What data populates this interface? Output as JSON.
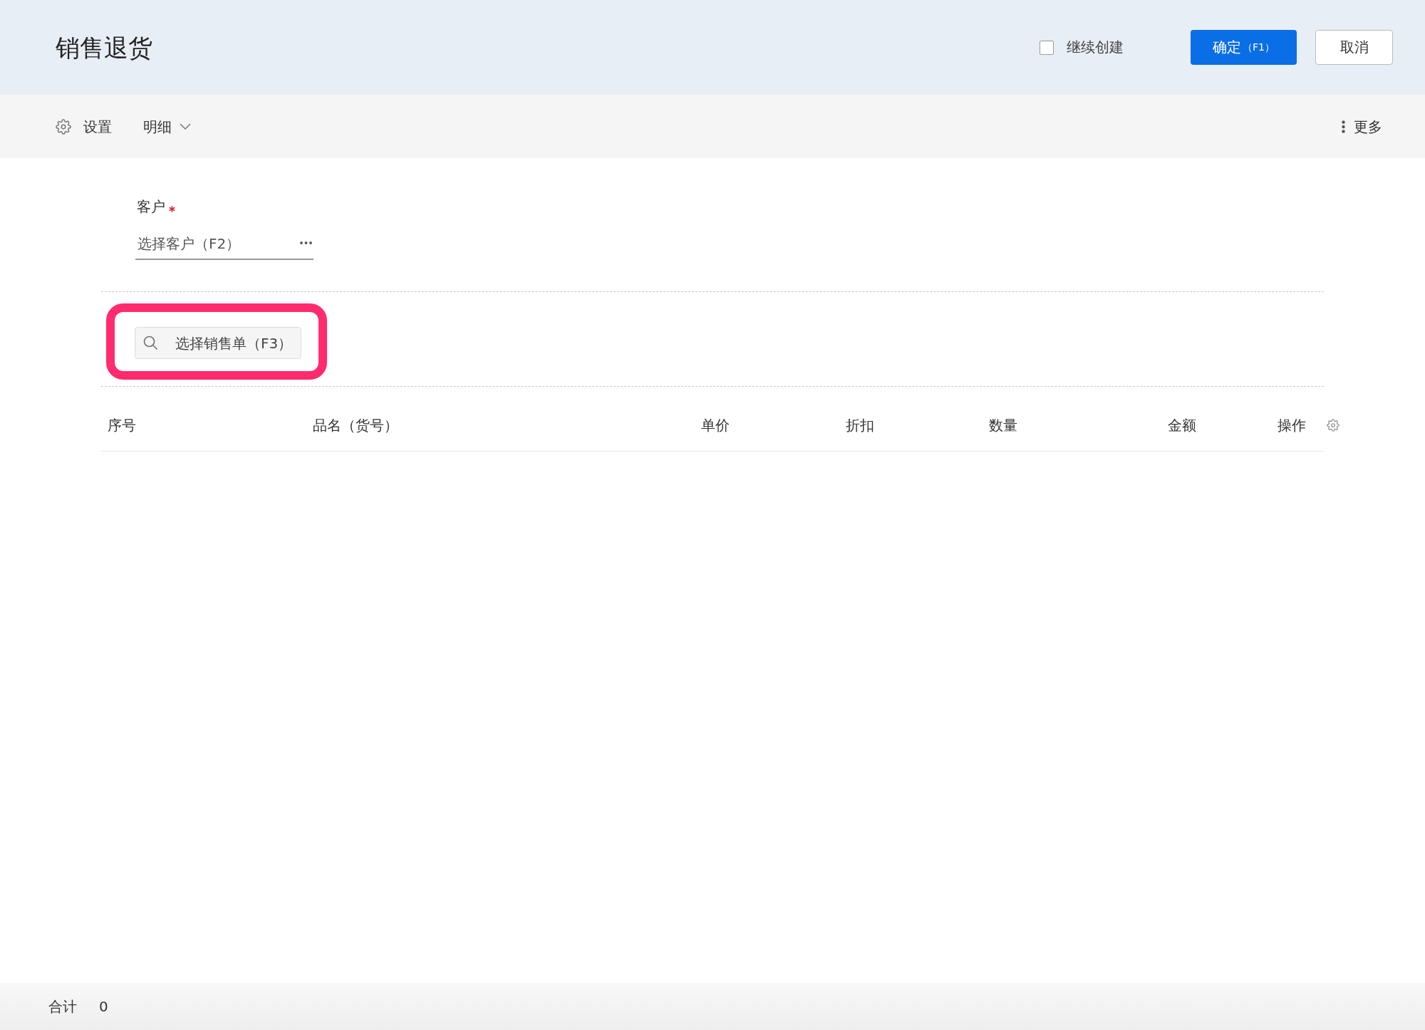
{
  "header": {
    "title": "销售退货",
    "continue_create": {
      "label": "继续创建",
      "checked": false
    },
    "buttons": [
      {
        "kind": "primary",
        "label": "确定",
        "shortcut": "（F1）"
      },
      {
        "kind": "secondary",
        "label": "取消"
      }
    ]
  },
  "toolbar": {
    "items": [
      {
        "kind": "settings",
        "label": "设置"
      },
      {
        "kind": "dropdown",
        "label": "明细",
        "expanded": false
      }
    ],
    "more": {
      "label": "更多"
    }
  },
  "form": {
    "customer": {
      "label": "客户",
      "required": true,
      "placeholder": "选择客户（F2）"
    }
  },
  "order_picker": {
    "placeholder": "选择销售单（F3）",
    "highlighted": true
  },
  "table": {
    "columns": [
      "序号",
      "品名（货号）",
      "单价",
      "折扣",
      "数量",
      "金额",
      "操作"
    ]
  },
  "footer": {
    "total_label": "合计",
    "total_value": "0"
  }
}
